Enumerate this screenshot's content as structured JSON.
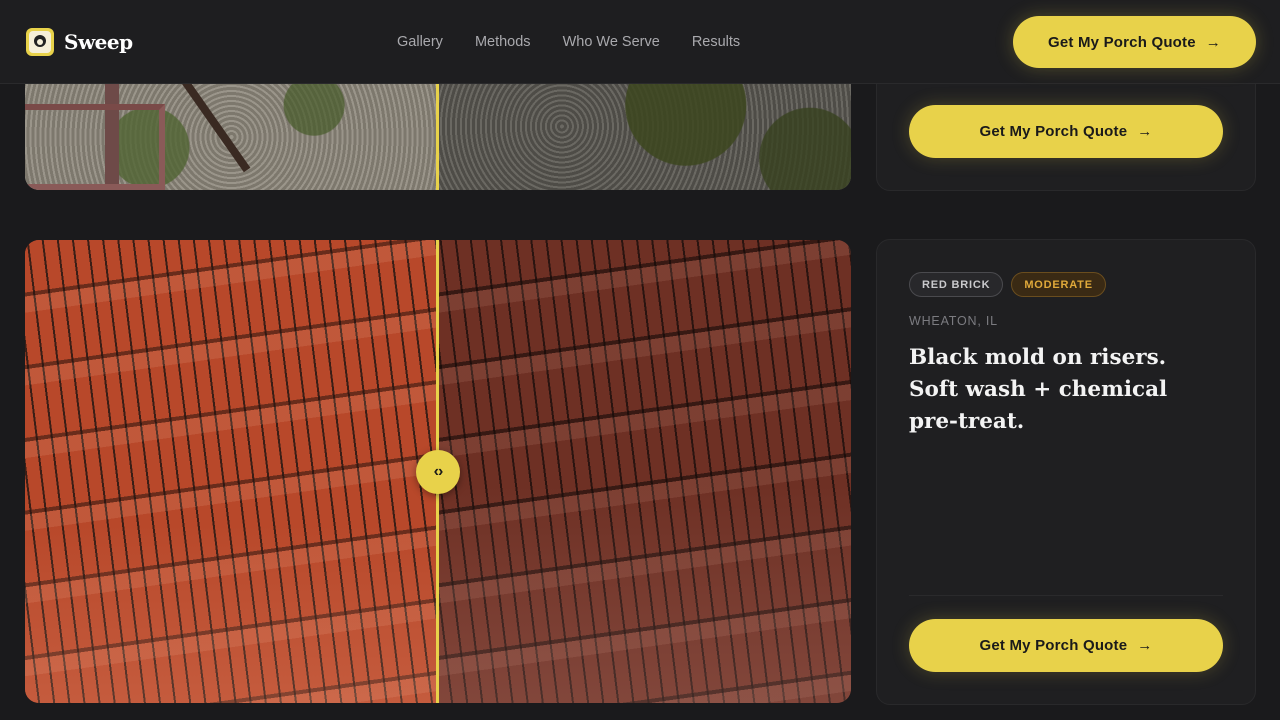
{
  "header": {
    "brand": "Sweep",
    "nav": [
      "Gallery",
      "Methods",
      "Who We Serve",
      "Results"
    ],
    "cta_label": "Get My Porch Quote",
    "cta_icon": "arrow-right-icon"
  },
  "projects": [
    {
      "cta_label": "Get My Porch Quote"
    },
    {
      "tags": [
        "RED BRICK",
        "MODERATE"
      ],
      "location": "WHEATON, IL",
      "description": "Black mold on risers. Soft wash + chemical pre-treat.",
      "cta_label": "Get My Porch Quote",
      "slider_icon": "code-chevrons-icon"
    }
  ],
  "colors": {
    "accent": "#e8d24a",
    "background": "#1a1a1c",
    "card": "#1f1f21",
    "moderate_badge": "#e0a93a"
  }
}
